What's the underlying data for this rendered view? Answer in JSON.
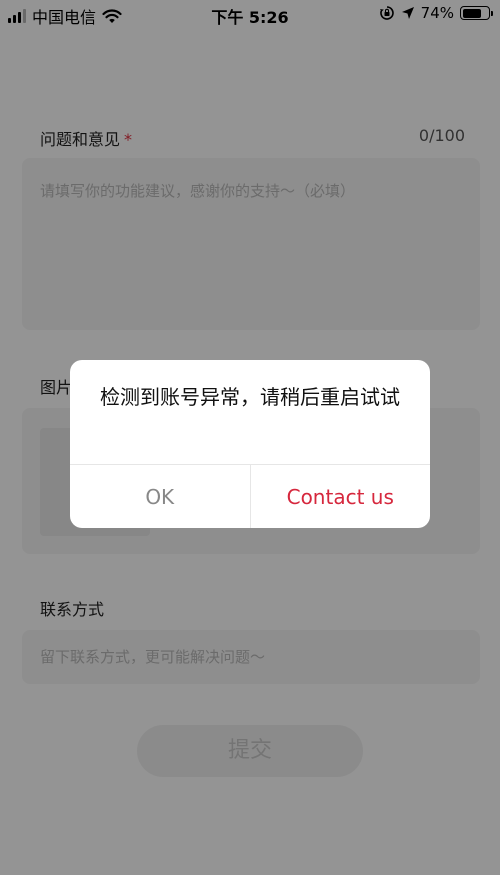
{
  "status_bar": {
    "carrier": "中国电信",
    "time": "下午 5:26",
    "battery_percent": "74%",
    "icons": [
      "signal-icon",
      "wifi-icon",
      "orientation-lock-icon",
      "location-arrow-icon",
      "battery-icon"
    ]
  },
  "form": {
    "feedback_label": "问题和意见",
    "required_mark": "*",
    "feedback_counter": "0/100",
    "feedback_placeholder": "请填写你的功能建议，感谢你的支持～（必填）",
    "image_label": "图片",
    "contact_label": "联系方式",
    "contact_placeholder": "留下联系方式，更可能解决问题～",
    "submit_label": "提交"
  },
  "dialog": {
    "message": "检测到账号异常，请稍后重启试试",
    "ok_label": "OK",
    "contact_label": "Contact us"
  },
  "colors": {
    "accent": "#d6273d",
    "required": "#e03040",
    "overlay": "rgba(0,0,0,0.42)"
  }
}
